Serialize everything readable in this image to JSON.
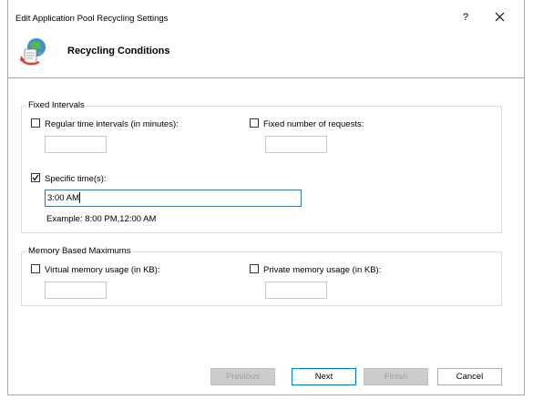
{
  "window": {
    "title": "Edit Application Pool Recycling Settings",
    "help_label": "?"
  },
  "header": {
    "title": "Recycling Conditions",
    "icon": "recycle-globe-icon"
  },
  "fixed_intervals": {
    "legend": "Fixed Intervals",
    "regular_time": {
      "label": "Regular time intervals (in minutes):",
      "checked": false,
      "value": ""
    },
    "fixed_requests": {
      "label": "Fixed number of requests:",
      "checked": false,
      "value": ""
    },
    "specific_times": {
      "label": "Specific time(s):",
      "checked": true,
      "value": "3:00 AM"
    },
    "example": "Example: 8:00 PM,12:00 AM"
  },
  "memory": {
    "legend": "Memory Based Maximums",
    "virtual": {
      "label": "Virtual memory usage (in KB):",
      "checked": false,
      "value": ""
    },
    "private": {
      "label": "Private memory usage (in KB):",
      "checked": false,
      "value": ""
    }
  },
  "buttons": {
    "previous": "Previous",
    "next": "Next",
    "finish": "Finish",
    "cancel": "Cancel"
  },
  "colors": {
    "accent": "#0078d7",
    "disabled_button": "#cccccc"
  }
}
